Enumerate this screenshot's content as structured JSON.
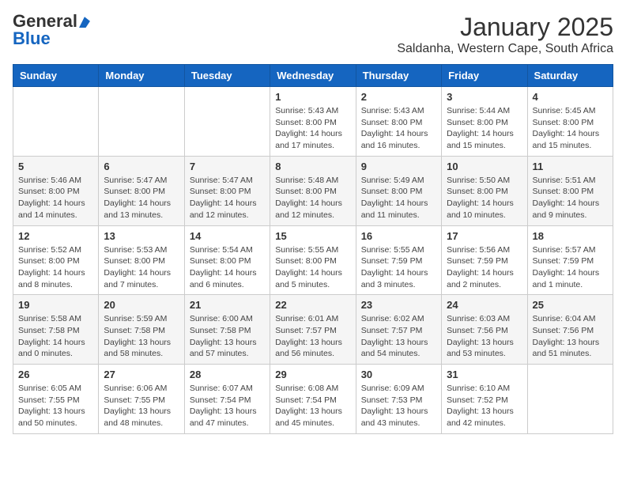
{
  "header": {
    "logo_general": "General",
    "logo_blue": "Blue",
    "month": "January 2025",
    "location": "Saldanha, Western Cape, South Africa"
  },
  "days_of_week": [
    "Sunday",
    "Monday",
    "Tuesday",
    "Wednesday",
    "Thursday",
    "Friday",
    "Saturday"
  ],
  "weeks": [
    [
      {
        "day": "",
        "info": ""
      },
      {
        "day": "",
        "info": ""
      },
      {
        "day": "",
        "info": ""
      },
      {
        "day": "1",
        "info": "Sunrise: 5:43 AM\nSunset: 8:00 PM\nDaylight: 14 hours\nand 17 minutes."
      },
      {
        "day": "2",
        "info": "Sunrise: 5:43 AM\nSunset: 8:00 PM\nDaylight: 14 hours\nand 16 minutes."
      },
      {
        "day": "3",
        "info": "Sunrise: 5:44 AM\nSunset: 8:00 PM\nDaylight: 14 hours\nand 15 minutes."
      },
      {
        "day": "4",
        "info": "Sunrise: 5:45 AM\nSunset: 8:00 PM\nDaylight: 14 hours\nand 15 minutes."
      }
    ],
    [
      {
        "day": "5",
        "info": "Sunrise: 5:46 AM\nSunset: 8:00 PM\nDaylight: 14 hours\nand 14 minutes."
      },
      {
        "day": "6",
        "info": "Sunrise: 5:47 AM\nSunset: 8:00 PM\nDaylight: 14 hours\nand 13 minutes."
      },
      {
        "day": "7",
        "info": "Sunrise: 5:47 AM\nSunset: 8:00 PM\nDaylight: 14 hours\nand 12 minutes."
      },
      {
        "day": "8",
        "info": "Sunrise: 5:48 AM\nSunset: 8:00 PM\nDaylight: 14 hours\nand 12 minutes."
      },
      {
        "day": "9",
        "info": "Sunrise: 5:49 AM\nSunset: 8:00 PM\nDaylight: 14 hours\nand 11 minutes."
      },
      {
        "day": "10",
        "info": "Sunrise: 5:50 AM\nSunset: 8:00 PM\nDaylight: 14 hours\nand 10 minutes."
      },
      {
        "day": "11",
        "info": "Sunrise: 5:51 AM\nSunset: 8:00 PM\nDaylight: 14 hours\nand 9 minutes."
      }
    ],
    [
      {
        "day": "12",
        "info": "Sunrise: 5:52 AM\nSunset: 8:00 PM\nDaylight: 14 hours\nand 8 minutes."
      },
      {
        "day": "13",
        "info": "Sunrise: 5:53 AM\nSunset: 8:00 PM\nDaylight: 14 hours\nand 7 minutes."
      },
      {
        "day": "14",
        "info": "Sunrise: 5:54 AM\nSunset: 8:00 PM\nDaylight: 14 hours\nand 6 minutes."
      },
      {
        "day": "15",
        "info": "Sunrise: 5:55 AM\nSunset: 8:00 PM\nDaylight: 14 hours\nand 5 minutes."
      },
      {
        "day": "16",
        "info": "Sunrise: 5:55 AM\nSunset: 7:59 PM\nDaylight: 14 hours\nand 3 minutes."
      },
      {
        "day": "17",
        "info": "Sunrise: 5:56 AM\nSunset: 7:59 PM\nDaylight: 14 hours\nand 2 minutes."
      },
      {
        "day": "18",
        "info": "Sunrise: 5:57 AM\nSunset: 7:59 PM\nDaylight: 14 hours\nand 1 minute."
      }
    ],
    [
      {
        "day": "19",
        "info": "Sunrise: 5:58 AM\nSunset: 7:58 PM\nDaylight: 14 hours\nand 0 minutes."
      },
      {
        "day": "20",
        "info": "Sunrise: 5:59 AM\nSunset: 7:58 PM\nDaylight: 13 hours\nand 58 minutes."
      },
      {
        "day": "21",
        "info": "Sunrise: 6:00 AM\nSunset: 7:58 PM\nDaylight: 13 hours\nand 57 minutes."
      },
      {
        "day": "22",
        "info": "Sunrise: 6:01 AM\nSunset: 7:57 PM\nDaylight: 13 hours\nand 56 minutes."
      },
      {
        "day": "23",
        "info": "Sunrise: 6:02 AM\nSunset: 7:57 PM\nDaylight: 13 hours\nand 54 minutes."
      },
      {
        "day": "24",
        "info": "Sunrise: 6:03 AM\nSunset: 7:56 PM\nDaylight: 13 hours\nand 53 minutes."
      },
      {
        "day": "25",
        "info": "Sunrise: 6:04 AM\nSunset: 7:56 PM\nDaylight: 13 hours\nand 51 minutes."
      }
    ],
    [
      {
        "day": "26",
        "info": "Sunrise: 6:05 AM\nSunset: 7:55 PM\nDaylight: 13 hours\nand 50 minutes."
      },
      {
        "day": "27",
        "info": "Sunrise: 6:06 AM\nSunset: 7:55 PM\nDaylight: 13 hours\nand 48 minutes."
      },
      {
        "day": "28",
        "info": "Sunrise: 6:07 AM\nSunset: 7:54 PM\nDaylight: 13 hours\nand 47 minutes."
      },
      {
        "day": "29",
        "info": "Sunrise: 6:08 AM\nSunset: 7:54 PM\nDaylight: 13 hours\nand 45 minutes."
      },
      {
        "day": "30",
        "info": "Sunrise: 6:09 AM\nSunset: 7:53 PM\nDaylight: 13 hours\nand 43 minutes."
      },
      {
        "day": "31",
        "info": "Sunrise: 6:10 AM\nSunset: 7:52 PM\nDaylight: 13 hours\nand 42 minutes."
      },
      {
        "day": "",
        "info": ""
      }
    ]
  ]
}
